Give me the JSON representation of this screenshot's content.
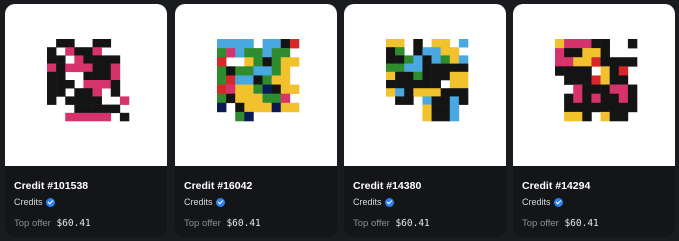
{
  "palette": {
    "w": "#ffffff",
    "k": "#141414",
    "p": "#d6336c",
    "g": "#2e8b2e",
    "b": "#4aa8e0",
    "y": "#f2c12e",
    "r": "#d62828",
    "n": "#0b1a55"
  },
  "cards": [
    {
      "title": "Credit #101538",
      "collection": "Credits",
      "offer_label": "Top offer",
      "offer_price": "$60.41",
      "art_rows": [
        "wkkwwkkww",
        "kwpkkpwww",
        "kkwpkkkkw",
        "pkpppkkpw",
        "kkwwkkkpw",
        "kkkwpppkw",
        "kkwkkpwkw",
        "kwkkkkwwp",
        "wwwkkkkkw",
        "wwpppppwk"
      ]
    },
    {
      "title": "Credit #16042",
      "collection": "Credits",
      "offer_label": "Top offer",
      "offer_price": "$60.41",
      "art_rows": [
        "bbbbwbbkr",
        "gpbggbggw",
        "rwwygkgyy",
        "gkggbbgyw",
        "grbbkgyyw",
        "rpyygnkyy",
        "gkyyyggpw",
        "nwkyyynyy",
        "wwgnwwwww"
      ]
    },
    {
      "title": "Credit #14380",
      "collection": "Credits",
      "offer_label": "Top offer",
      "offer_price": "$60.41",
      "art_rows": [
        "yywkwyywb",
        "kgwkbbyyw",
        "kkgbkbgyb",
        "ggbbkkkkk",
        "ykkgkkkyy",
        "kkkkkkwyy",
        "ybkyyykkk",
        "wkkwbkkbk",
        "wwwwykkbw",
        "wwwwykkbw"
      ]
    },
    {
      "title": "Credit #14294",
      "collection": "Credits",
      "offer_label": "Top offer",
      "offer_price": "$60.41",
      "art_rows": [
        "ypppkkwwk",
        "pkkyykwww",
        "ppyyrkkkk",
        "kkkkwykrw",
        "wkkkrykkw",
        "wwpkkkppk",
        "wkpkpkkpk",
        "wkkkkkkkk",
        "wyykwykkw"
      ]
    }
  ]
}
